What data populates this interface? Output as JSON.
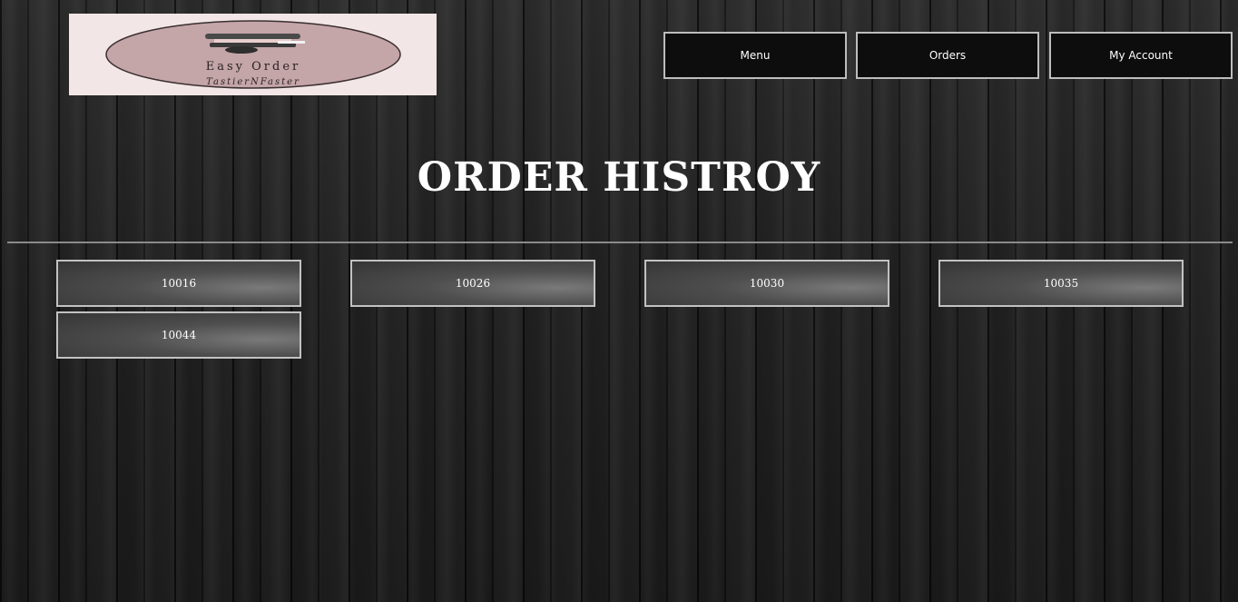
{
  "logo": {
    "brand": "Easy Order",
    "tagline": "TastierNFaster"
  },
  "nav": {
    "menu_label": "Menu",
    "orders_label": "Orders",
    "account_label": "My Account"
  },
  "page": {
    "title": "ORDER HISTROY"
  },
  "orders": [
    "10016",
    "10026",
    "10030",
    "10035",
    "10044"
  ],
  "colors": {
    "logo_background": "#f3e6e6",
    "logo_ellipse": "#c4a5a8",
    "button_border": "#bdbdbd"
  }
}
